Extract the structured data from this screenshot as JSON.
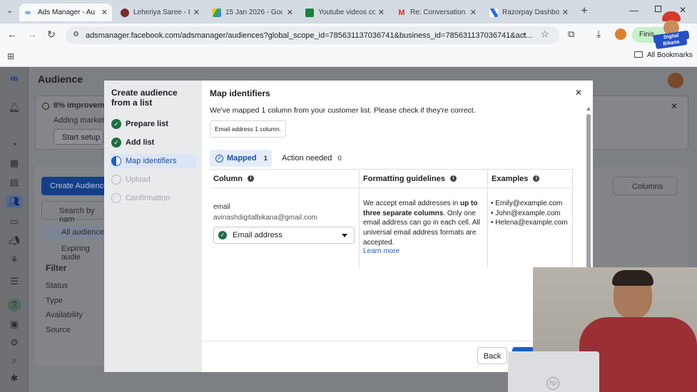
{
  "browser": {
    "tabs": [
      {
        "title": "Ads Manager - Au",
        "color": "#1a73e8",
        "active": true
      },
      {
        "title": "Leheriya Saree - II",
        "color": "#7a2e2e"
      },
      {
        "title": "15 Jan 2026 - Goo",
        "color": "#34a853"
      },
      {
        "title": "Youtube videos co",
        "color": "#188038"
      },
      {
        "title": "Re: Conversation w",
        "color": "#d93025"
      },
      {
        "title": "Razorpay Dashbo",
        "color": "#2d6ae3"
      }
    ],
    "new_tab": "+",
    "url": "adsmanager.facebook.com/adsmanager/audiences?global_scope_id=785631137036741&business_id=785631137036741&act...",
    "finish_label": "Finis",
    "all_bookmarks": "All Bookmarks"
  },
  "page": {
    "title": "Audience",
    "banner_title": "8% improveme",
    "banner_sub": "Adding marketi",
    "start_setup": "Start setup",
    "create_audience": "Create Audience",
    "search_placeholder": "Search by nam",
    "all_audiences": "All audiences",
    "expiring": "Expiring audie",
    "filter_title": "Filter",
    "filters": [
      "Status",
      "Type",
      "Availability",
      "Source"
    ],
    "columns_label": "Columns"
  },
  "modal": {
    "left_title": "Create audience from a list",
    "steps": [
      {
        "label": "Prepare list",
        "state": "done"
      },
      {
        "label": "Add list",
        "state": "done"
      },
      {
        "label": "Map identifiers",
        "state": "current"
      },
      {
        "label": "Upload",
        "state": "pending"
      },
      {
        "label": "Confirmation",
        "state": "pending"
      }
    ],
    "title": "Map identifiers",
    "subtitle": "We've mapped 1 column from your customer list. Please check if they're correct.",
    "chip_label": "Email address",
    "chip_count": "1 column.",
    "tabs": [
      {
        "label": "Mapped",
        "count": "1",
        "active": true
      },
      {
        "label": "Action needed",
        "count": "0",
        "active": false
      }
    ],
    "col_headers": [
      "Column",
      "Formatting guidelines",
      "Examples"
    ],
    "row": {
      "col_name": "email",
      "sample": "avinashdigitalbikana@gmail.com",
      "mapping": "Email address",
      "guide_pre": "We accept email addresses in ",
      "guide_bold": "up to three separate columns",
      "guide_post": ". Only one email address can go in each cell. All universal email address formats are accepted.",
      "learn_more": "Learn more",
      "examples": [
        "Emily@example.com",
        "John@example.com",
        "Helena@example.com"
      ]
    },
    "back_label": "Back"
  }
}
